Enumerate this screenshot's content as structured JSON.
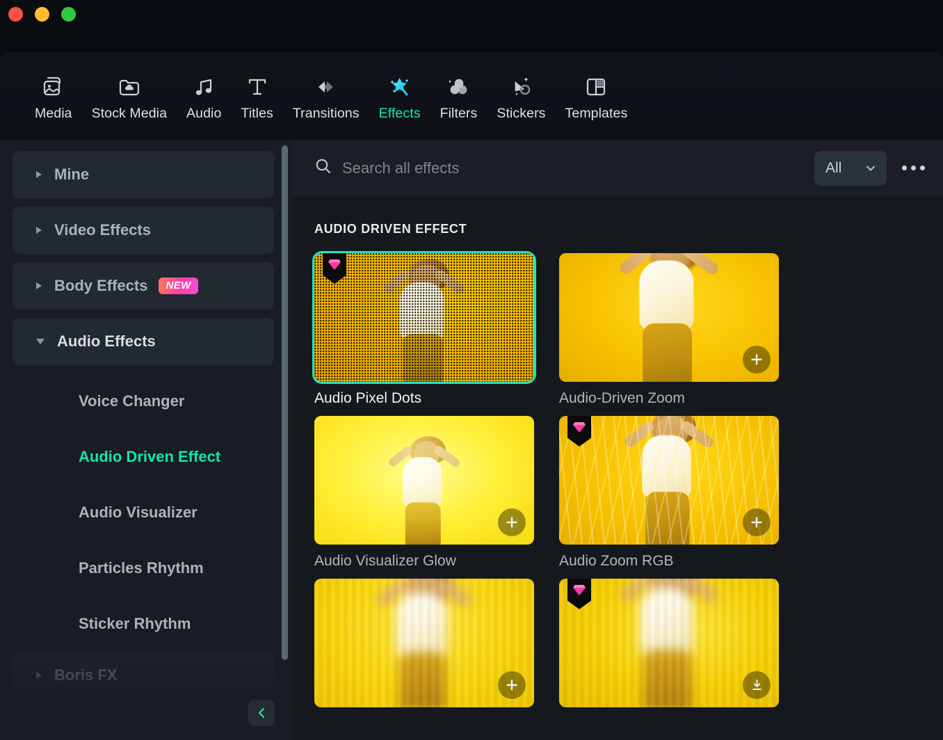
{
  "window": {
    "traffic_lights": [
      "close",
      "minimize",
      "maximize"
    ]
  },
  "topnav": {
    "items": [
      {
        "label": "Media",
        "icon": "media-image-icon",
        "active": false
      },
      {
        "label": "Stock Media",
        "icon": "folder-cloud-icon",
        "active": false
      },
      {
        "label": "Audio",
        "icon": "music-note-icon",
        "active": false
      },
      {
        "label": "Titles",
        "icon": "text-t-icon",
        "active": false
      },
      {
        "label": "Transitions",
        "icon": "transition-arrows-icon",
        "active": false
      },
      {
        "label": "Effects",
        "icon": "magic-wand-star-icon",
        "active": true
      },
      {
        "label": "Filters",
        "icon": "three-circles-icon",
        "active": false
      },
      {
        "label": "Stickers",
        "icon": "sticker-shapes-icon",
        "active": false
      },
      {
        "label": "Templates",
        "icon": "layout-grid-icon",
        "active": false
      }
    ],
    "accent_color": "#22e6b0"
  },
  "sidebar": {
    "categories": [
      {
        "label": "Mine",
        "expanded": false,
        "badge": null,
        "dimmed": false
      },
      {
        "label": "Video Effects",
        "expanded": false,
        "badge": null,
        "dimmed": false
      },
      {
        "label": "Body Effects",
        "expanded": false,
        "badge": "NEW",
        "dimmed": false
      },
      {
        "label": "Audio Effects",
        "expanded": true,
        "badge": null,
        "dimmed": false
      }
    ],
    "subitems": [
      {
        "label": "Voice Changer",
        "active": false
      },
      {
        "label": "Audio Driven Effect",
        "active": true
      },
      {
        "label": "Audio Visualizer",
        "active": false
      },
      {
        "label": "Particles Rhythm",
        "active": false
      },
      {
        "label": "Sticker Rhythm",
        "active": false
      }
    ],
    "trailing_category": {
      "label": "Boris FX",
      "expanded": false,
      "dimmed": true
    },
    "collapse_icon": "chevron-left-icon",
    "active_color": "#16e3a6"
  },
  "search": {
    "placeholder": "Search all effects",
    "value": "",
    "icon": "search-icon"
  },
  "filter": {
    "selected": "All",
    "chevron": "chevron-down-icon"
  },
  "more_menu": {
    "icon": "ellipsis-icon"
  },
  "main": {
    "section_title": "AUDIO DRIVEN EFFECT",
    "cards": [
      {
        "label": "Audio Pixel Dots",
        "selected": true,
        "badge": "gem-badge",
        "action": "add",
        "art": "pixel-dots"
      },
      {
        "label": "Audio-Driven Zoom",
        "selected": false,
        "badge": null,
        "action": "add",
        "art": "zoom"
      },
      {
        "label": "Audio Visualizer Glow",
        "selected": false,
        "badge": null,
        "action": "add",
        "art": "glow"
      },
      {
        "label": "Audio Zoom RGB",
        "selected": false,
        "badge": "gem-badge",
        "action": "add",
        "art": "rgb"
      },
      {
        "label": "",
        "selected": false,
        "badge": null,
        "action": "add",
        "art": "blur1"
      },
      {
        "label": "",
        "selected": false,
        "badge": "gem-badge",
        "action": "download",
        "art": "blur2"
      }
    ],
    "selection_color": "#1fe3c0",
    "gem_color": "#f63ea0"
  }
}
